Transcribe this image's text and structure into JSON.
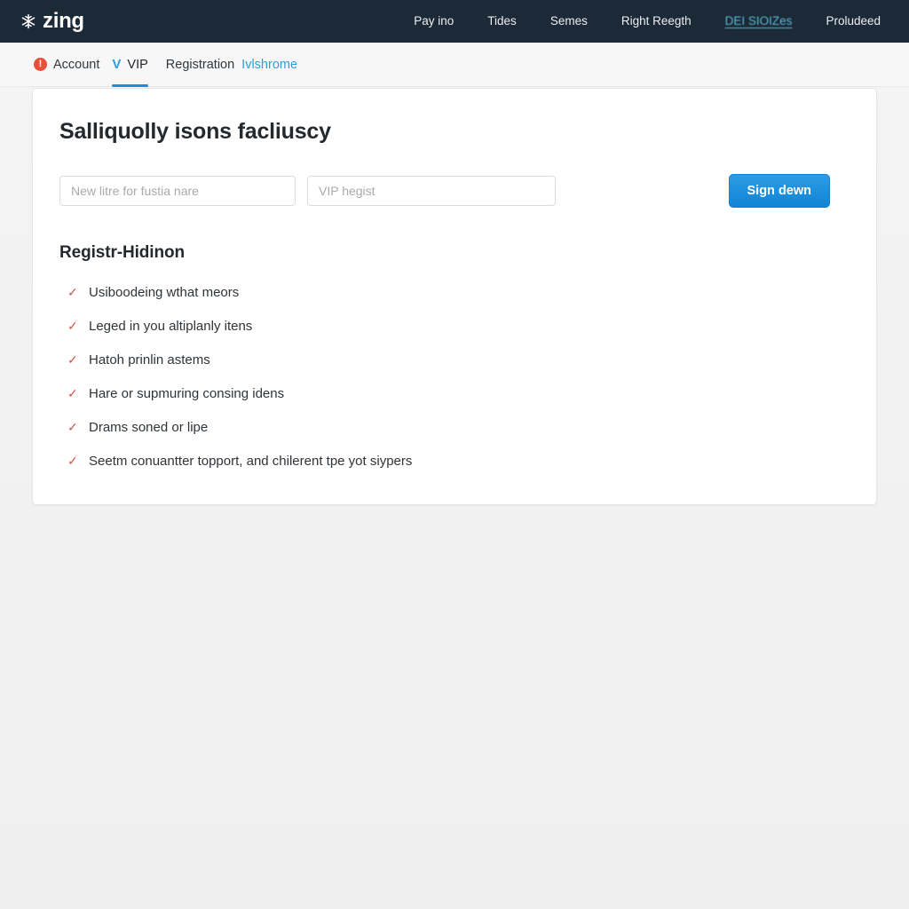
{
  "header": {
    "brand": "zing",
    "brand_icon": "snowflake-icon",
    "nav": [
      {
        "label": "Pay ino",
        "style": "plain"
      },
      {
        "label": "Tides",
        "style": "plain"
      },
      {
        "label": "Semes",
        "style": "plain"
      },
      {
        "label": "Right Reegth",
        "style": "plain"
      },
      {
        "label": "DEI SIOIZes",
        "style": "link"
      },
      {
        "label": "Proludeed",
        "style": "plain"
      }
    ],
    "background_color": "#1c2936",
    "link_color": "#5bb8d8"
  },
  "tabs": {
    "account": {
      "label": "Account",
      "badge": "!",
      "badge_color": "#e8503a"
    },
    "vip": {
      "label": "VIP",
      "icon": "v-icon",
      "active": true,
      "underline_color": "#1b8ed6"
    },
    "registration": {
      "label": "Registration"
    },
    "sub_link": {
      "label": "Ivlshrome",
      "color": "#2b9fd9"
    }
  },
  "card": {
    "title": "Salliquolly isons facliuscy",
    "fields": {
      "first_placeholder": "New litre for fustia nare",
      "second_placeholder": "VIP hegist",
      "first_value": "",
      "second_value": ""
    },
    "submit_label": "Sign dewn",
    "submit_color": "#1e8fe0",
    "section_title": "Registr-Hidinon",
    "checklist": [
      "Usiboodeing wthat meors",
      "Leged in you altiplanly itens",
      "Hatoh prinlin astems",
      "Hare or supmuring consing idens",
      "Drams soned or lipe",
      "Seetm conuantter topport, and chilerent tpe yot siypers"
    ],
    "check_color": "#d4564a"
  }
}
